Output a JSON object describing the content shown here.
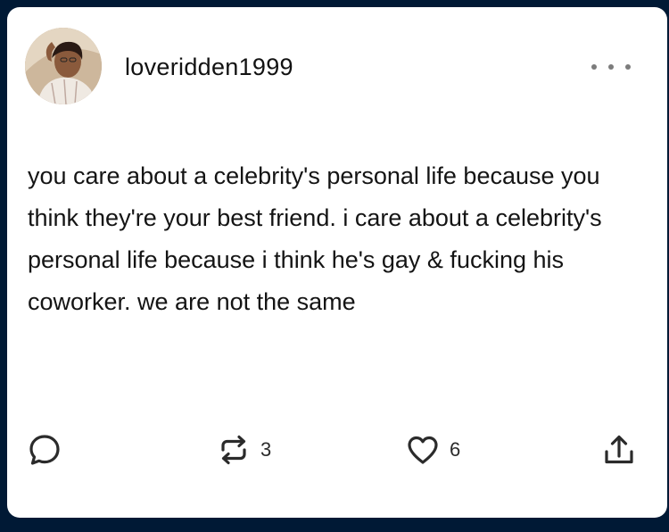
{
  "post": {
    "author": {
      "username": "loveridden1999",
      "avatar_icon": "profile-photo"
    },
    "body": "you care about a celebrity's personal life because you think they're your best friend. i care about a celebrity's personal life because i think he's gay & fucking his coworker. we are not the same",
    "menu_icon": "more-options-icon"
  },
  "actions": {
    "reply": {
      "icon": "comment-icon",
      "count": ""
    },
    "reblog": {
      "icon": "reblog-icon",
      "count": "3"
    },
    "like": {
      "icon": "heart-icon",
      "count": "6"
    },
    "share": {
      "icon": "share-icon",
      "count": ""
    }
  },
  "colors": {
    "page_background": "#001935",
    "card_background": "#ffffff",
    "icon_color": "#2b2b2b"
  }
}
